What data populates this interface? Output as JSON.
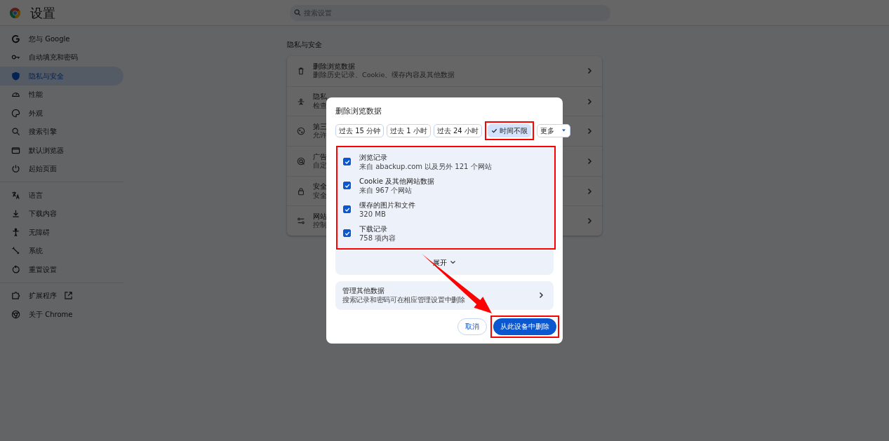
{
  "window": {
    "title": "设置"
  },
  "search": {
    "placeholder": "搜索设置"
  },
  "sidebar": {
    "groups": [
      {
        "items": [
          {
            "label": "您与 Google",
            "selected": false
          },
          {
            "label": "自动填充和密码",
            "selected": false
          },
          {
            "label": "隐私与安全",
            "selected": true
          },
          {
            "label": "性能",
            "selected": false
          },
          {
            "label": "外观",
            "selected": false
          },
          {
            "label": "搜索引擎",
            "selected": false
          },
          {
            "label": "默认浏览器",
            "selected": false
          },
          {
            "label": "起始页面",
            "selected": false
          }
        ]
      },
      {
        "items": [
          {
            "label": "语言",
            "selected": false
          },
          {
            "label": "下载内容",
            "selected": false
          },
          {
            "label": "无障碍",
            "selected": false
          },
          {
            "label": "系统",
            "selected": false
          },
          {
            "label": "重置设置",
            "selected": false
          }
        ]
      },
      {
        "items": [
          {
            "label": "扩展程序",
            "selected": false,
            "external": true
          },
          {
            "label": "关于 Chrome",
            "selected": false
          }
        ]
      }
    ]
  },
  "main": {
    "section_title": "隐私与安全",
    "rows": [
      {
        "title": "删除浏览数据",
        "subtitle": "删除历史记录、Cookie、缓存内容及其他数据"
      },
      {
        "title": "隐私",
        "subtitle": "检查"
      },
      {
        "title": "第三",
        "subtitle": "允许"
      },
      {
        "title": "广告",
        "subtitle": "自定"
      },
      {
        "title": "安全",
        "subtitle": "安全"
      },
      {
        "title": "网站",
        "subtitle": "控制"
      }
    ]
  },
  "dialog": {
    "title": "删除浏览数据",
    "ranges": [
      {
        "label": "过去 15 分钟",
        "selected": false,
        "highlighted": false
      },
      {
        "label": "过去 1 小时",
        "selected": false,
        "highlighted": false
      },
      {
        "label": "过去 24 小时",
        "selected": false,
        "highlighted": false
      },
      {
        "label": "时间不限",
        "selected": true,
        "highlighted": true
      }
    ],
    "more": "更多",
    "items_highlighted": true,
    "items": [
      {
        "title": "浏览记录",
        "detail": "来自 abackup.com 以及另外 121 个网站",
        "checked": true
      },
      {
        "title": "Cookie 及其他网站数据",
        "detail": "来自 967 个网站",
        "checked": true
      },
      {
        "title": "缓存的图片和文件",
        "detail": "320 MB",
        "checked": true
      },
      {
        "title": "下载记录",
        "detail": "758 项内容",
        "checked": true
      }
    ],
    "expand": "展开",
    "manage": {
      "title": "管理其他数据",
      "subtitle": "搜索记录和密码可在相应管理设置中删除"
    },
    "buttons": [
      {
        "label": "取消",
        "kind": "secondary",
        "highlighted": false
      },
      {
        "label": "从此设备中删除",
        "kind": "primary",
        "highlighted": true
      }
    ],
    "annotation_arrow": true
  }
}
